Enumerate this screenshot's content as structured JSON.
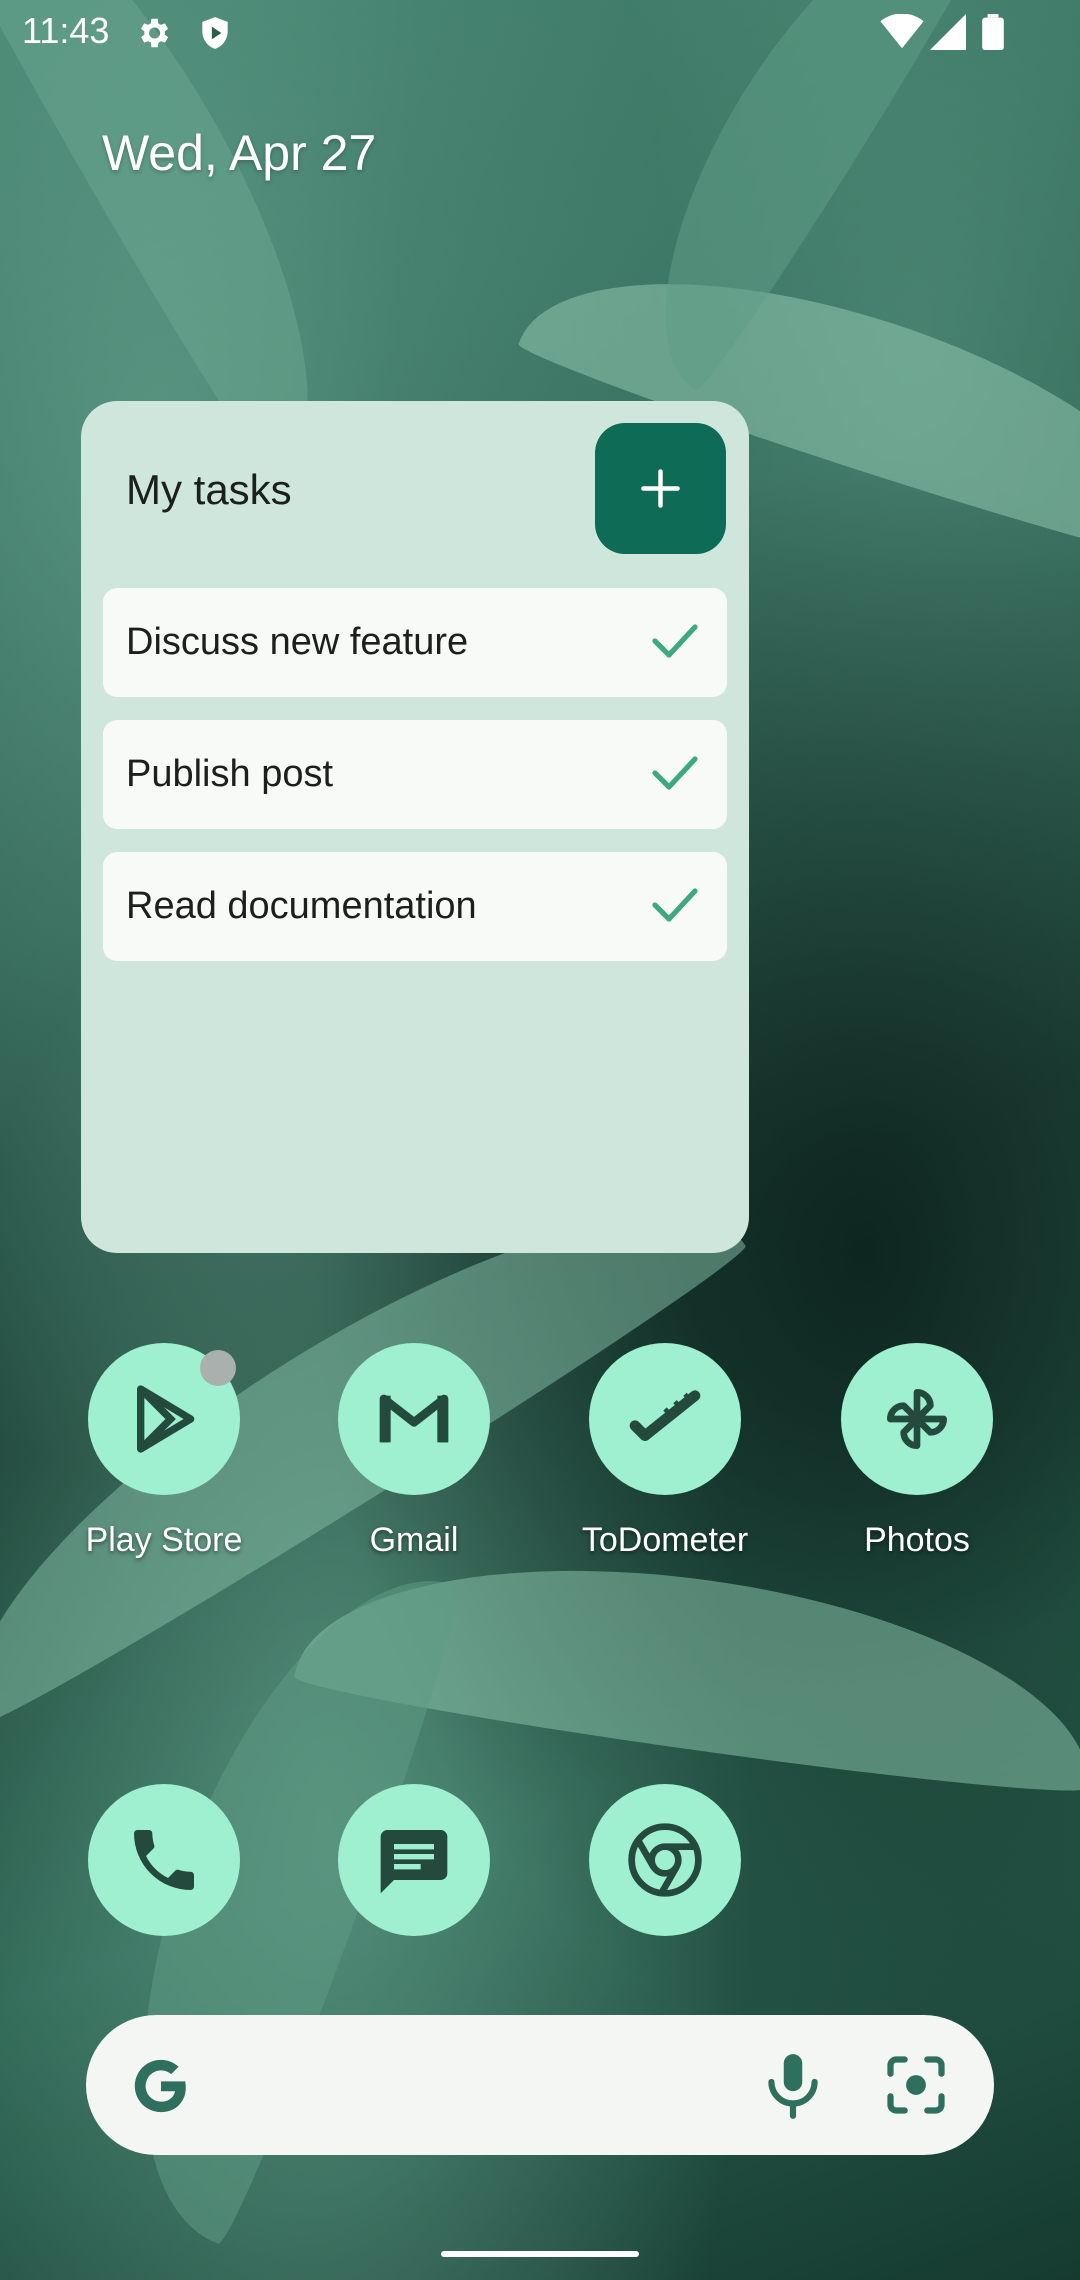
{
  "status_bar": {
    "time": "11:43",
    "left_icons": [
      "settings-icon",
      "shield-icon"
    ],
    "right_icons": [
      "wifi-icon",
      "signal-icon",
      "battery-icon"
    ]
  },
  "date": "Wed, Apr 27",
  "widget": {
    "title": "My tasks",
    "add_icon": "plus-icon",
    "tasks": [
      {
        "label": "Discuss new feature",
        "icon": "check-icon"
      },
      {
        "label": "Publish post",
        "icon": "check-icon"
      },
      {
        "label": "Read documentation",
        "icon": "check-icon"
      }
    ]
  },
  "apps": [
    {
      "label": "Play Store",
      "icon": "play-store-icon",
      "has_notification_dot": true
    },
    {
      "label": "Gmail",
      "icon": "gmail-icon"
    },
    {
      "label": "ToDometer",
      "icon": "todometer-icon"
    },
    {
      "label": "Photos",
      "icon": "photos-icon"
    }
  ],
  "dock": [
    {
      "icon": "phone-icon"
    },
    {
      "icon": "messages-icon"
    },
    {
      "icon": "chrome-icon"
    }
  ],
  "search_bar": {
    "icons": [
      "google-g-icon",
      "mic-icon",
      "lens-icon"
    ]
  },
  "colors": {
    "widget_bg": "#cfe6dc",
    "accent": "#0e6b55",
    "app_icon_bg": "#9ef0d0",
    "check": "#3ea882"
  }
}
